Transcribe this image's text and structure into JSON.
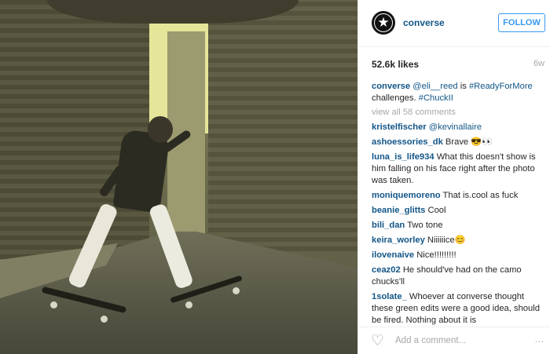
{
  "post": {
    "photo_alt": "",
    "account": "converse",
    "follow_label": "FOLLOW",
    "likes": "52.6k likes",
    "age": "6w",
    "caption": {
      "user": "converse",
      "text_parts": [
        "@eli__reed",
        " is ",
        "#ReadyForMore",
        " challenges. ",
        "#ChuckII"
      ]
    },
    "view_all": "view all 58 comments",
    "comments": [
      {
        "user": "kristelfischer",
        "text": "@kevinallaire"
      },
      {
        "user": "ashoessories_dk",
        "text": "Brave 😎👀"
      },
      {
        "user": "luna_is_life934",
        "text": "What this doesn't show is him falling on his face right after the photo was taken."
      },
      {
        "user": "moniquemoreno",
        "text": "That is.cool as fuck"
      },
      {
        "user": "beanie_glitts",
        "text": "Cool"
      },
      {
        "user": "bili_dan",
        "text": "Two tone"
      },
      {
        "user": "keira_worley",
        "text": "Niiiiiice😊"
      },
      {
        "user": "ilovenaive",
        "text": "Nice!!!!!!!!!"
      },
      {
        "user": "ceaz02",
        "text": "He should've had on the camo chucks'll"
      },
      {
        "user": "1solate_",
        "text": "Whoever at converse thought these green edits were a good idea, should be fired. Nothing about it is"
      }
    ],
    "add_comment_placeholder": "Add a comment...",
    "more_label": "..."
  },
  "icons": {
    "heart": "heart-icon",
    "logo": "converse-star-icon",
    "more": "more-options-icon"
  },
  "colors": {
    "link_blue": "#125688",
    "follow_blue": "#3897f0",
    "muted": "#a5a7aa"
  }
}
